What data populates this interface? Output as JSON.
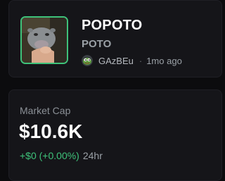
{
  "token": {
    "name": "POPOTO",
    "ticker": "POTO",
    "creator": "GAzBEu",
    "separator": "·",
    "created_ago": "1mo ago",
    "accent_color": "#3ec27a",
    "image_icon": "hippo-photo",
    "avatar_icon": "pepe-frog-icon"
  },
  "market_cap": {
    "label": "Market Cap",
    "value": "$10.6K",
    "change": "+$0 (+0.00%)",
    "period": "24hr",
    "change_color": "#3ec27a"
  }
}
